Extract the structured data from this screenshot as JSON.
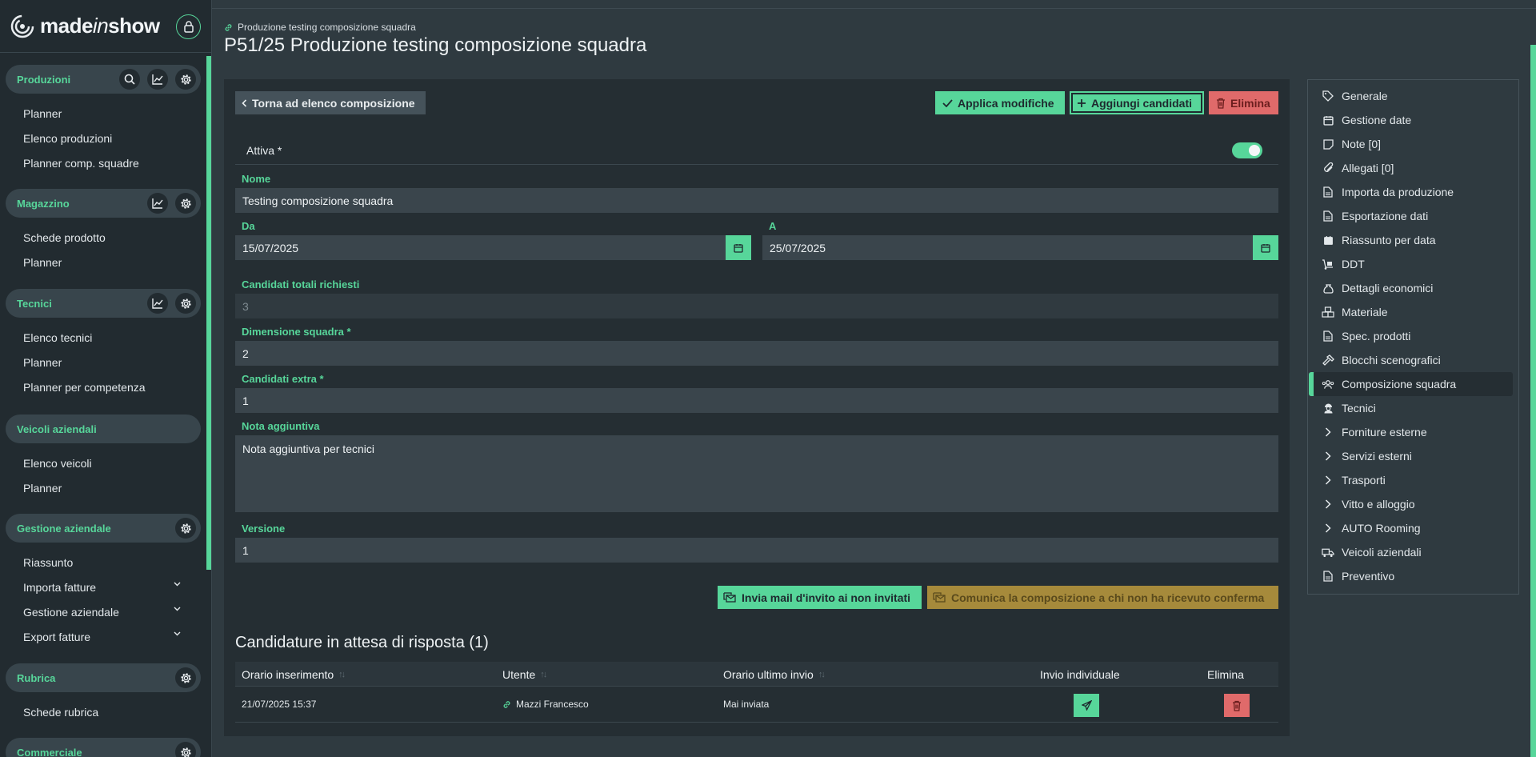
{
  "brand": {
    "part1": "made",
    "part2": "in",
    "part3": "show"
  },
  "sidebar": {
    "sections": [
      {
        "title": "Produzioni",
        "items": [
          "Planner",
          "Elenco produzioni",
          "Planner comp. squadre"
        ]
      },
      {
        "title": "Magazzino",
        "items": [
          "Schede prodotto",
          "Planner"
        ]
      },
      {
        "title": "Tecnici",
        "items": [
          "Elenco tecnici",
          "Planner",
          "Planner per competenza"
        ]
      },
      {
        "title": "Veicoli aziendali",
        "items": [
          "Elenco veicoli",
          "Planner"
        ]
      },
      {
        "title": "Gestione aziendale",
        "items": [
          "Riassunto",
          "Importa fatture",
          "Gestione aziendale",
          "Export fatture"
        ]
      },
      {
        "title": "Rubrica",
        "items": [
          "Schede rubrica"
        ]
      },
      {
        "title": "Commerciale",
        "items": []
      }
    ]
  },
  "header": {
    "breadcrumb": "Produzione testing composizione squadra",
    "title": "P51/25 Produzione testing composizione squadra"
  },
  "toolbar": {
    "back": "Torna ad elenco composizione",
    "apply": "Applica modifiche",
    "add": "Aggiungi candidati",
    "delete": "Elimina"
  },
  "form": {
    "active_label": "Attiva *",
    "active": true,
    "name_label": "Nome",
    "name": "Testing composizione squadra",
    "from_label": "Da",
    "from": "15/07/2025",
    "to_label": "A",
    "to": "25/07/2025",
    "total_label": "Candidati totali richiesti",
    "total": "3",
    "size_label": "Dimensione squadra *",
    "size": "2",
    "extra_label": "Candidati extra *",
    "extra": "1",
    "note_label": "Nota aggiuntiva",
    "note": "Nota aggiuntiva per tecnici",
    "version_label": "Versione",
    "version": "1"
  },
  "actions": {
    "invite": "Invia mail d'invito ai non invitati",
    "communicate": "Comunica la composizione a chi non ha ricevuto conferma"
  },
  "pending": {
    "title": "Candidature in attesa di risposta (1)",
    "columns": [
      "Orario inserimento",
      "Utente",
      "Orario ultimo invio",
      "Invio individuale",
      "Elimina"
    ],
    "rows": [
      {
        "inserted": "21/07/2025 15:37",
        "user": "Mazzi Francesco",
        "last_sent": "Mai inviata"
      }
    ]
  },
  "right_menu": [
    {
      "label": "Generale",
      "icon": "tag-icon"
    },
    {
      "label": "Gestione date",
      "icon": "calendar-icon"
    },
    {
      "label": "Note [0]",
      "icon": "note-icon"
    },
    {
      "label": "Allegati [0]",
      "icon": "paperclip-icon"
    },
    {
      "label": "Importa da produzione",
      "icon": "file-import-icon"
    },
    {
      "label": "Esportazione dati",
      "icon": "file-export-icon"
    },
    {
      "label": "Riassunto per data",
      "icon": "calendar-check-icon"
    },
    {
      "label": "DDT",
      "icon": "dolly-icon"
    },
    {
      "label": "Dettagli economici",
      "icon": "money-bag-icon"
    },
    {
      "label": "Materiale",
      "icon": "boxes-icon"
    },
    {
      "label": "Spec. prodotti",
      "icon": "file-lines-icon"
    },
    {
      "label": "Blocchi scenografici",
      "icon": "hammer-icon"
    },
    {
      "label": "Composizione squadra",
      "icon": "users-icon"
    },
    {
      "label": "Tecnici",
      "icon": "user-helmet-icon"
    },
    {
      "label": "Forniture esterne",
      "icon": "chevron-right-icon"
    },
    {
      "label": "Servizi esterni",
      "icon": "chevron-right-icon"
    },
    {
      "label": "Trasporti",
      "icon": "chevron-right-icon"
    },
    {
      "label": "Vitto e alloggio",
      "icon": "chevron-right-icon"
    },
    {
      "label": "AUTO Rooming",
      "icon": "chevron-right-icon"
    },
    {
      "label": "Veicoli aziendali",
      "icon": "truck-icon"
    },
    {
      "label": "Preventivo",
      "icon": "file-invoice-icon"
    }
  ],
  "colors": {
    "accent": "#57d69a",
    "danger": "#e06a6a",
    "warning": "#a68a3b",
    "bg": "#2f3a40",
    "sidebar": "#222b30"
  }
}
